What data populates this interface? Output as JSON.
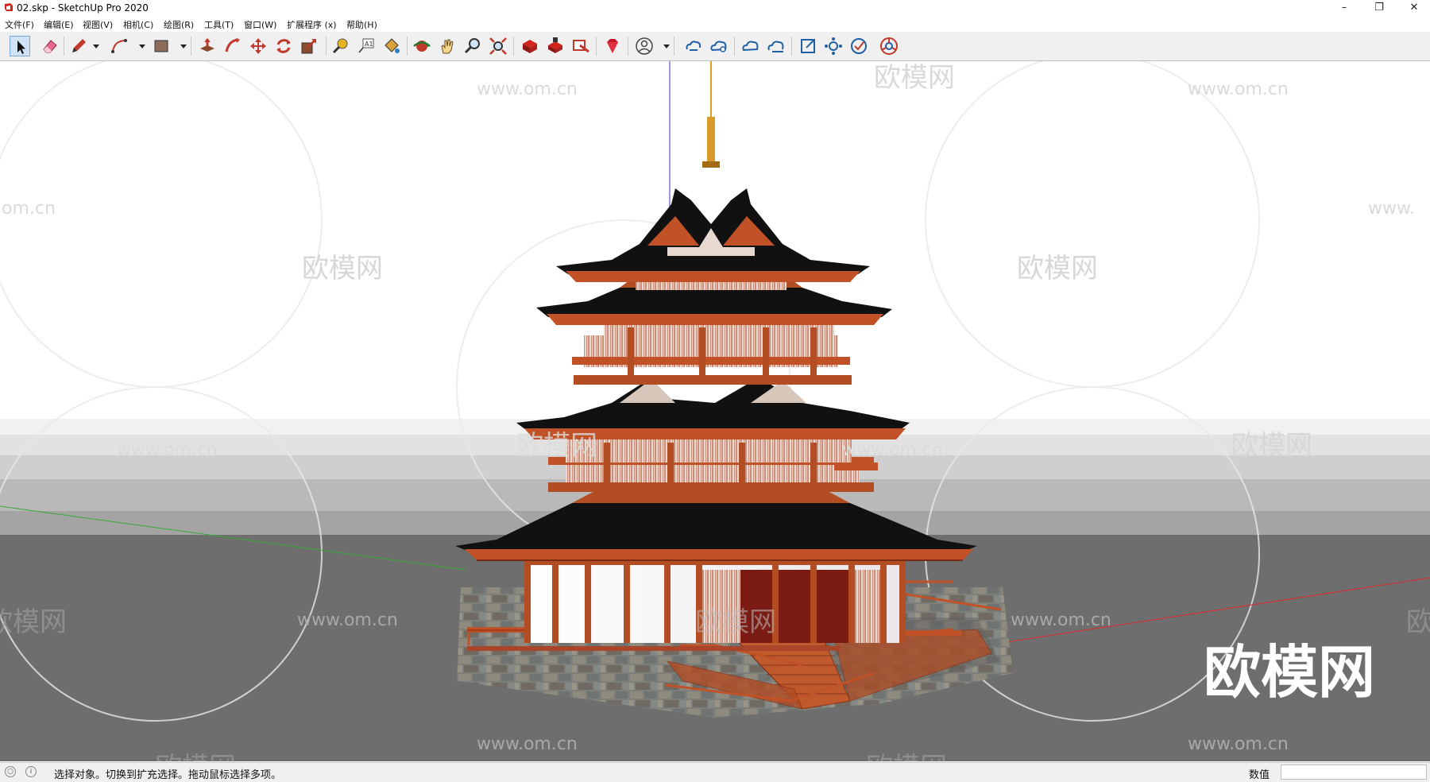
{
  "window": {
    "title": "02.skp - SketchUp Pro 2020",
    "minimize": "–",
    "restore": "❐",
    "close": "✕"
  },
  "menu": [
    "文件(F)",
    "编辑(E)",
    "视图(V)",
    "相机(C)",
    "绘图(R)",
    "工具(T)",
    "窗口(W)",
    "扩展程序 (x)",
    "帮助(H)"
  ],
  "toolbar": {
    "tools": [
      "select-tool",
      "eraser-tool",
      "pencil-tool",
      "arc-tool",
      "rectangle-tool",
      "push-pull-tool",
      "follow-me-tool",
      "move-tool",
      "rotate-tool",
      "scale-tool",
      "tape-measure-tool",
      "text-tool",
      "paint-bucket-tool",
      "orbit-tool",
      "pan-tool",
      "zoom-tool",
      "zoom-extents-tool",
      "3d-warehouse-tool",
      "extension-warehouse-tool",
      "layout-tool",
      "ruby-tool",
      "account-tool",
      "cloud-sync-tool",
      "cloud-upload-tool",
      "cloud-tool",
      "cloud-download-tool",
      "export-tool",
      "settings-tool",
      "check-tool",
      "chrome-tool"
    ],
    "active": "select-tool"
  },
  "viewport": {
    "brand_watermark": "欧模网",
    "url_watermark": "www.om.cn",
    "partial_url_left": "om.cn",
    "partial_url_right": "www.",
    "partial_brand_left": "欧模网",
    "partial_brand_right": "欧",
    "big_logo": "欧模网"
  },
  "status": {
    "text": "选择对象。切换到扩充选择。拖动鼠标选择多项。",
    "measurements_label": "数值",
    "measurements_value": ""
  },
  "colors": {
    "toolbar_bg": "#f0f0f0",
    "sky": "#ffffff",
    "ground": "#6e6e6e",
    "wood": "#b24d24",
    "roof": "#111111",
    "stone": "#7b7e7a",
    "axis_red": "#cc3333",
    "axis_green": "#33aa33",
    "axis_blue": "#3333cc"
  }
}
